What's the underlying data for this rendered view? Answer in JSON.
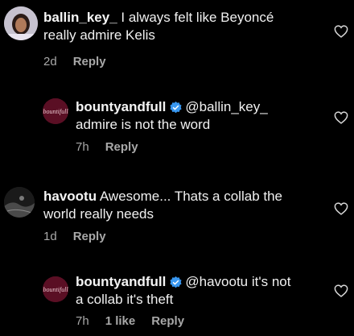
{
  "comments": [
    {
      "username": "ballin_key_",
      "text_line1": " I always felt like Beyoncé",
      "text_line2": "really admire Kelis",
      "time": "2d",
      "reply_label": "Reply"
    },
    {
      "username": "bountyandfull",
      "mention": "@ballin_key_",
      "text_line2": "admire is not the word",
      "time": "7h",
      "reply_label": "Reply",
      "avatar_text": "bountifull"
    },
    {
      "username": "havootu",
      "text_line1": " Awesome... Thats a collab the",
      "text_line2": "world really needs",
      "time": "1d",
      "reply_label": "Reply"
    },
    {
      "username": "bountyandfull",
      "mention_and_text": "@havootu it's not",
      "text_line2": "a collab it's theft",
      "time": "7h",
      "likes": "1 like",
      "reply_label": "Reply",
      "avatar_text": "bountifull"
    }
  ],
  "colors": {
    "background": "#000000",
    "text": "#f0f0f0",
    "meta": "#a8a8a8",
    "verified": "#3897f0",
    "brand_avatar": "#5a0f24"
  },
  "icons": [
    "heart-icon",
    "verified-badge-icon"
  ]
}
